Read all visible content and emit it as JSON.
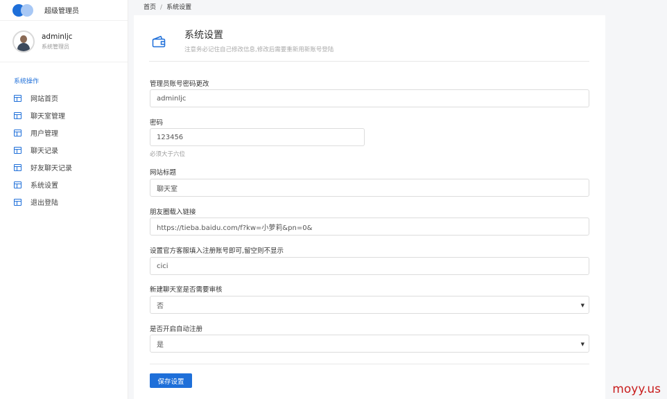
{
  "brand": {
    "title": "超级管理员"
  },
  "user": {
    "name": "adminljc",
    "role": "系统管理员"
  },
  "nav": {
    "heading": "系统操作",
    "items": [
      {
        "label": "网站首页"
      },
      {
        "label": "聊天室管理"
      },
      {
        "label": "用户管理"
      },
      {
        "label": "聊天记录"
      },
      {
        "label": "好友聊天记录"
      },
      {
        "label": "系统设置"
      },
      {
        "label": "退出登陆"
      }
    ]
  },
  "breadcrumb": {
    "home": "首页",
    "separator": "/",
    "current": "系统设置"
  },
  "card": {
    "title": "系统设置",
    "subtitle": "注意务必记住自己修改信息,修改后需要重新用新账号登陆"
  },
  "form": {
    "account": {
      "label": "管理员账号密码更改",
      "value": "adminljc"
    },
    "password": {
      "label": "密码",
      "value": "123456",
      "hint": "必须大于六位"
    },
    "site_title": {
      "label": "网站标题",
      "value": "聊天室"
    },
    "moments_link": {
      "label": "朋友圈载入链接",
      "value": "https://tieba.baidu.com/f?kw=小萝莉&pn=0&"
    },
    "service_account": {
      "label": "设置官方客服填入注册账号即可,留空则不显示",
      "value": "cici"
    },
    "room_review": {
      "label": "新建聊天室是否需要审核",
      "value": "否"
    },
    "auto_register": {
      "label": "是否开启自动注册",
      "value": "是"
    },
    "save_label": "保存设置"
  },
  "watermark": "moyy.us",
  "colors": {
    "accent": "#1e6fd9",
    "watermark": "#c81c1c"
  }
}
